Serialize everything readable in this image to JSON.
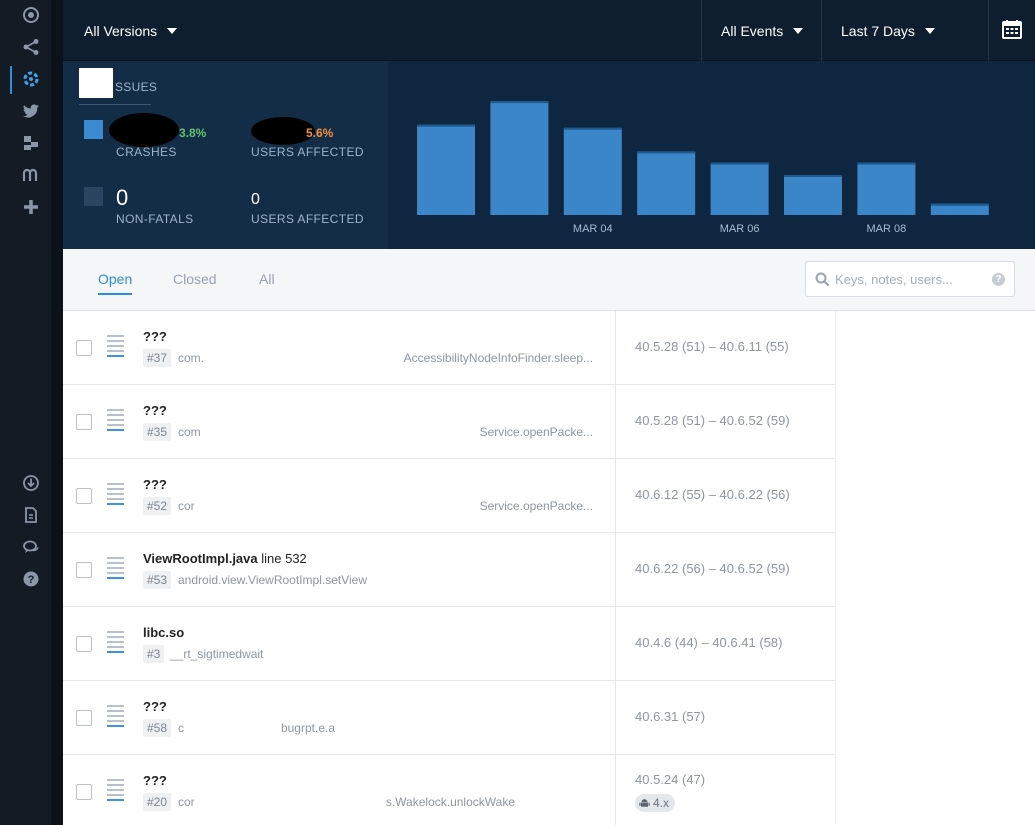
{
  "rail": {
    "icons": [
      "target-icon",
      "share-icon",
      "crashlytics-icon",
      "twitter-icon",
      "beta-icon",
      "mopub-icon",
      "add-icon",
      "download-icon",
      "document-icon",
      "chat-icon",
      "help-icon"
    ]
  },
  "topbar": {
    "versions": "All Versions",
    "events": "All Events",
    "range": "Last 7 Days"
  },
  "stats": {
    "title": "SSUES",
    "crashes_label": "CRASHES",
    "crashes_pct": "3.8%",
    "crashes_users_label": "USERS AFFECTED",
    "crashes_users_pct": "5.6%",
    "nonfatals_value": "0",
    "nonfatals_label": "NON-FATALS",
    "nonfatals_users_value": "0",
    "nonfatals_users_label": "USERS AFFECTED",
    "colors": {
      "crash": "#3c8bd0",
      "nonfatal": "#2b4560",
      "pct_up": "#5dc36f",
      "pct_warn": "#f1913a"
    }
  },
  "chart_data": {
    "type": "bar",
    "categories": [
      "",
      "",
      "",
      "",
      "",
      "",
      "",
      ""
    ],
    "values": [
      88,
      111,
      85,
      62,
      51,
      39,
      51,
      11
    ],
    "ticks": [
      {
        "label": "MAR 04",
        "index": 2
      },
      {
        "label": "MAR 06",
        "index": 4
      },
      {
        "label": "MAR 08",
        "index": 6
      }
    ],
    "title": "",
    "xlabel": "",
    "ylabel": "",
    "ylim": [
      0,
      115
    ],
    "grid": false,
    "color": "#3a86c8"
  },
  "filters": {
    "tabs": [
      "Open",
      "Closed",
      "All"
    ],
    "active_tab": "Open",
    "search_placeholder": "Keys, notes, users...",
    "help": "?"
  },
  "issues": [
    {
      "title": "???",
      "title_suffix": "",
      "num": "#37",
      "sub_left": "com.",
      "sub_right": "AccessibilityNodeInfoFinder.sleep...",
      "versions": "40.5.28 (51) – 40.6.11 (55)",
      "tag": ""
    },
    {
      "title": "???",
      "title_suffix": "",
      "num": "#35",
      "sub_left": "com",
      "sub_right": "Service.openPacke...",
      "versions": "40.5.28 (51) – 40.6.52 (59)",
      "tag": ""
    },
    {
      "title": "???",
      "title_suffix": "",
      "num": "#52",
      "sub_left": "cor",
      "sub_right": "Service.openPacke...",
      "versions": "40.6.12 (55) – 40.6.22 (56)",
      "tag": ""
    },
    {
      "title": "ViewRootImpl.java",
      "title_suffix": " line 532",
      "num": "#53",
      "sub_left": "android.view.ViewRootImpl.setView",
      "sub_right": "",
      "versions": "40.6.22 (56) – 40.6.52 (59)",
      "tag": ""
    },
    {
      "title": "libc.so",
      "title_suffix": "",
      "num": "#3",
      "sub_left": "__rt_sigtimedwait",
      "sub_right": "",
      "versions": "40.4.6 (44) – 40.6.41 (58)",
      "tag": ""
    },
    {
      "title": "???",
      "title_suffix": "",
      "num": "#58",
      "sub_left": "c",
      "sub_right": "bugrpt.e.a",
      "versions": "40.6.31 (57)",
      "tag": ""
    },
    {
      "title": "???",
      "title_suffix": "",
      "num": "#20",
      "sub_left": "cor",
      "sub_right": "s.Wakelock.unlockWake",
      "versions": "40.5.24 (47)",
      "tag": "4.x"
    }
  ]
}
